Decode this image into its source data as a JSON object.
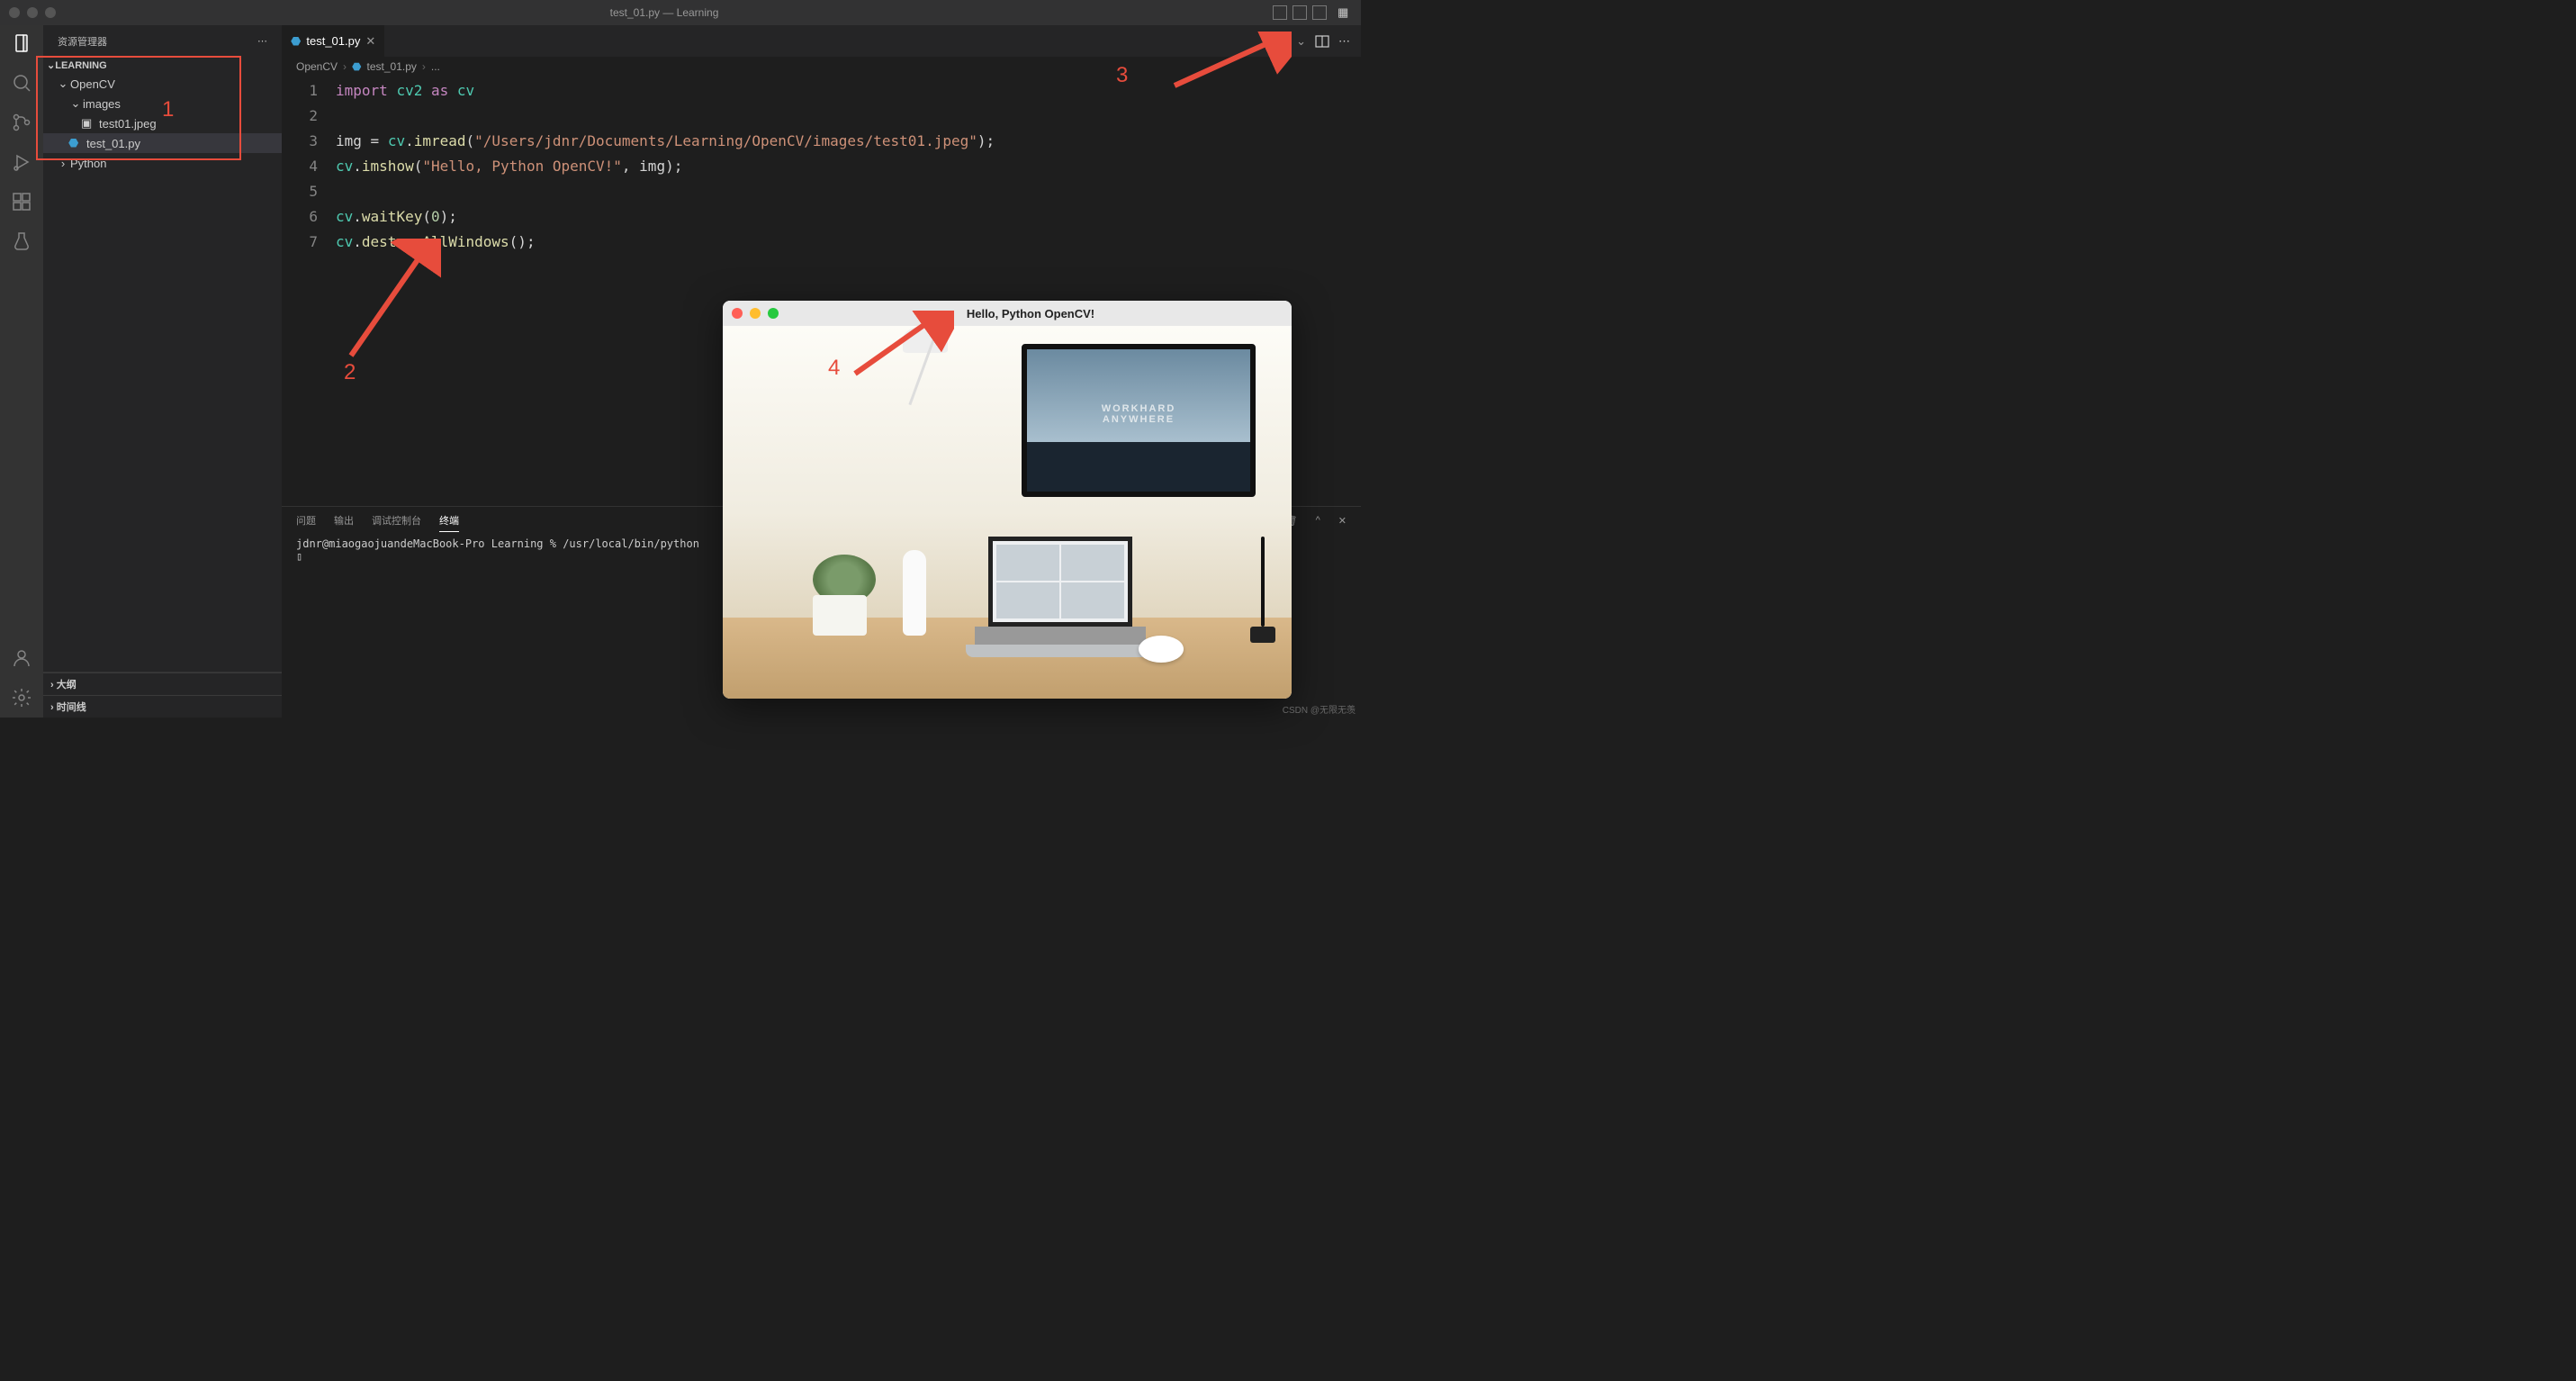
{
  "titlebar": {
    "title": "test_01.py — Learning"
  },
  "sidebar": {
    "title": "资源管理器",
    "workspace": "LEARNING",
    "tree": {
      "opencv": "OpenCV",
      "images": "images",
      "test01": "test01.jpeg",
      "testpy": "test_01.py",
      "python": "Python"
    },
    "outline": "大纲",
    "timeline": "时间线"
  },
  "tab": {
    "name": "test_01.py"
  },
  "breadcrumb": {
    "a": "OpenCV",
    "b": "test_01.py",
    "c": "..."
  },
  "code": {
    "l1_import": "import",
    "l1_cv2": "cv2",
    "l1_as": "as",
    "l1_cv": "cv",
    "l3_img": "img",
    "l3_eq": " = ",
    "l3_cv": "cv",
    "l3_imread": "imread",
    "l3_path": "\"/Users/jdnr/Documents/Learning/OpenCV/images/test01.jpeg\"",
    "l4_cv": "cv",
    "l4_imshow": "imshow",
    "l4_s1": "\"Hello, Python OpenCV!\"",
    "l4_img": "img",
    "l6_cv": "cv",
    "l6_wait": "waitKey",
    "l6_zero": "0",
    "l7_cv": "cv",
    "l7_destroy": "destroyAllWindows"
  },
  "line_numbers": [
    "1",
    "2",
    "3",
    "4",
    "5",
    "6",
    "7"
  ],
  "panel": {
    "tabs": {
      "problems": "问题",
      "output": "输出",
      "debug": "调试控制台",
      "terminal": "终端"
    },
    "prompt": "jdnr@miaogaojuandeMacBook-Pro Learning % /usr/local/bin/python",
    "cursor": "▯"
  },
  "imgwin": {
    "title": "Hello, Python OpenCV!"
  },
  "annotations": {
    "n1": "1",
    "n2": "2",
    "n3": "3",
    "n4": "4"
  },
  "watermark": "CSDN @无限无羡"
}
